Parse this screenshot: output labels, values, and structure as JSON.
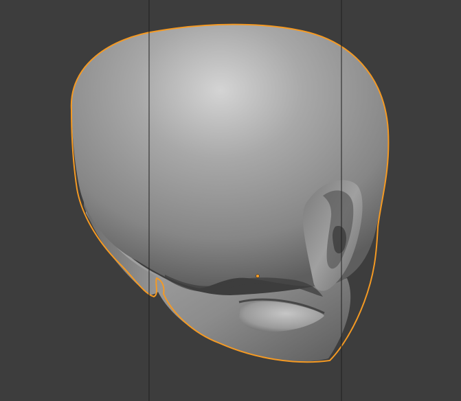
{
  "viewport": {
    "background_color": "#3d3d3d",
    "grid_line_color": "#1e1e1e"
  },
  "object": {
    "name": "head-mesh",
    "selected": true,
    "outline_color": "#f59a23",
    "origin_color": "#f59a23",
    "base_color": "#8e8e8e",
    "highlight_color": "#d4d4d4",
    "shadow_color": "#4a4a4a"
  }
}
